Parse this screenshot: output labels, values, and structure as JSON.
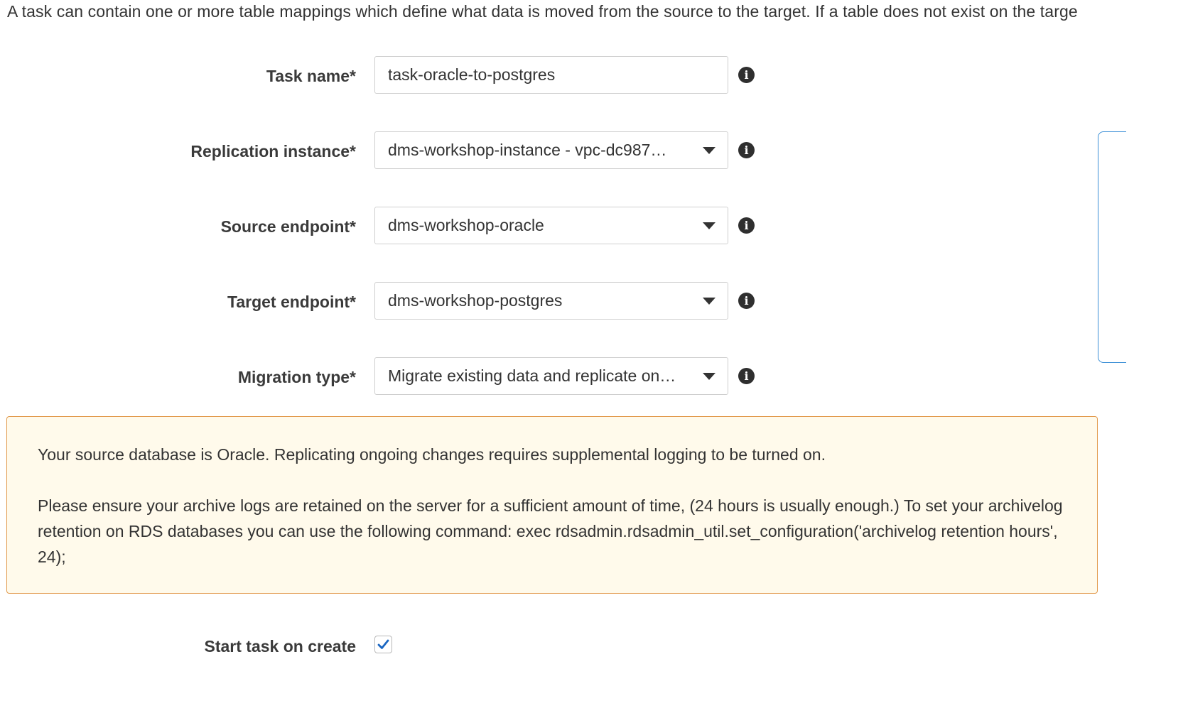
{
  "intro_text": "A task can contain one or more table mappings which define what data is moved from the source to the target. If a table does not exist on the targe",
  "form": {
    "task_name": {
      "label": "Task name*",
      "value": "task-oracle-to-postgres",
      "info_icon": "info-icon"
    },
    "replication_instance": {
      "label": "Replication instance*",
      "value": "dms-workshop-instance - vpc-dc987…",
      "info_icon": "info-icon"
    },
    "source_endpoint": {
      "label": "Source endpoint*",
      "value": "dms-workshop-oracle",
      "info_icon": "info-icon"
    },
    "target_endpoint": {
      "label": "Target endpoint*",
      "value": "dms-workshop-postgres",
      "info_icon": "info-icon"
    },
    "migration_type": {
      "label": "Migration type*",
      "value": "Migrate existing data and replicate on…",
      "info_icon": "info-icon"
    }
  },
  "warning": {
    "line1": "Your source database is Oracle. Replicating ongoing changes requires supplemental logging to be turned on.",
    "line2": "Please ensure your archive logs are retained on the server for a sufficient amount of time, (24 hours is usually enough.) To set your archivelog retention on RDS databases you can use the following command: exec rdsadmin.rdsadmin_util.set_configuration('archivelog retention hours', 24);"
  },
  "start_task": {
    "label": "Start task on create",
    "checked": true
  },
  "colors": {
    "warning_bg": "#fffaeb",
    "warning_border": "#e29a4d",
    "checkmark": "#1a66c2",
    "panel_edge": "#3b8fd6"
  }
}
